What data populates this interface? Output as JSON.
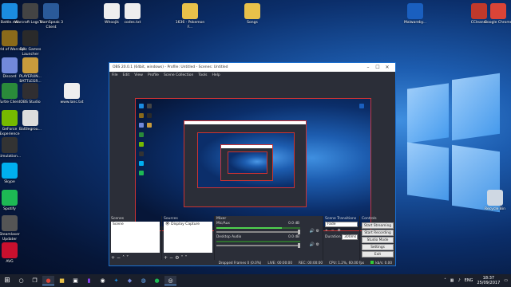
{
  "desktop": {
    "icons_left": [
      {
        "label": "Battle.net",
        "icon": "battlenet-icon",
        "color": "#1b8ce0"
      },
      {
        "label": "World of Warcraft",
        "icon": "wow-icon",
        "color": "#8a6a1a"
      },
      {
        "label": "Discord",
        "icon": "discord-icon",
        "color": "#7289da"
      },
      {
        "label": "Turtle Client",
        "icon": "turtle-icon",
        "color": "#2a8a3a"
      },
      {
        "label": "GeForce Experience",
        "icon": "geforce-icon",
        "color": "#76b900"
      },
      {
        "label": "Simulation...",
        "icon": "game-icon",
        "color": "#333333"
      },
      {
        "label": "Skype",
        "icon": "skype-icon",
        "color": "#00aff0"
      },
      {
        "label": "Spotify",
        "icon": "spotify-icon",
        "color": "#1db954"
      },
      {
        "label": "Steamlaser Updater",
        "icon": "gear-icon",
        "color": "#555555"
      },
      {
        "label": "AVG",
        "icon": "avg-icon",
        "color": "#c8102e"
      }
    ],
    "icons_col2": [
      {
        "label": "Warcraft Logs U...",
        "icon": "warcraftlogs-icon",
        "color": "#444444"
      },
      {
        "label": "Epic Games Launcher",
        "icon": "epic-icon",
        "color": "#2a2a2a"
      },
      {
        "label": "PLAYERUN... BATTLEGR...",
        "icon": "pubg-icon",
        "color": "#c89b3c"
      },
      {
        "label": "OBS Studio",
        "icon": "obs-icon",
        "color": "#302e31"
      },
      {
        "label": "Battlegrou...",
        "icon": "file-icon",
        "color": "#dddddd"
      }
    ],
    "icons_top": [
      {
        "label": "TeamSpeak 3 Client",
        "icon": "teamspeak-icon",
        "color": "#2a5a9a"
      },
      {
        "label": "Whoojik",
        "icon": "file-icon",
        "color": "#eeeeee"
      },
      {
        "label": "codes.txt",
        "icon": "text-file-icon",
        "color": "#eeeeee"
      },
      {
        "label": "1636 - Pokemon F...",
        "icon": "folder-icon",
        "color": "#e8c14a"
      },
      {
        "label": "Songs",
        "icon": "folder-icon",
        "color": "#e8c14a"
      },
      {
        "label": "www.lanc.txt",
        "icon": "text-file-icon",
        "color": "#eeeeee"
      }
    ],
    "icons_right": [
      {
        "label": "Malwareby...",
        "icon": "malwarebytes-icon",
        "color": "#1a5fbf"
      },
      {
        "label": "CCleaner",
        "icon": "ccleaner-icon",
        "color": "#c0392b"
      },
      {
        "label": "Google Chrome",
        "icon": "chrome-icon",
        "color": "#db4437"
      },
      {
        "label": "Recycle Bin",
        "icon": "recycle-bin-icon",
        "color": "#cfd8e3"
      }
    ]
  },
  "obs": {
    "title": "OBS 20.0.1 (64bit, windows) - Profile: Untitled - Scenes: Untitled",
    "menu": [
      "File",
      "Edit",
      "View",
      "Profile",
      "Scene Collection",
      "Tools",
      "Help"
    ],
    "docks": {
      "scenes": {
        "title": "Scenes",
        "items": [
          "Scene"
        ]
      },
      "sources": {
        "title": "Sources",
        "items": [
          "Display Capture"
        ]
      },
      "mixer": {
        "title": "Mixer",
        "channels": [
          {
            "name": "Mic/Aux",
            "db": "0.0 dB",
            "level": 0.78
          },
          {
            "name": "Desktop Audio",
            "db": "0.0 dB",
            "level": 0.0
          }
        ]
      },
      "transitions": {
        "title": "Scene Transitions",
        "type": "Fade",
        "duration_label": "Duration",
        "duration": "300ms"
      },
      "controls": {
        "title": "Controls",
        "buttons": [
          "Start Streaming",
          "Start Recording",
          "Studio Mode",
          "Settings",
          "Exit"
        ]
      }
    },
    "status": {
      "dropped": "Dropped Frames 0 (0.0%)",
      "live": "LIVE: 00:00:00",
      "rec": "REC: 00:00:00",
      "cpu": "CPU: 1.2%, 60.00 fps",
      "kbps": "kb/s: 0.00"
    }
  },
  "taskbar": {
    "lang": "ENG",
    "time": "18:37",
    "date": "25/09/2017"
  }
}
